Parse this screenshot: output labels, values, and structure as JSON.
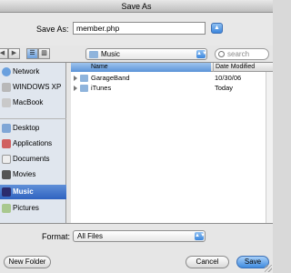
{
  "window": {
    "title": "Save As"
  },
  "save_as": {
    "label": "Save As:",
    "value": "member.php"
  },
  "toolbar": {
    "back_icon": "arrow-left",
    "forward_icon": "arrow-right",
    "list_view_icon": "list",
    "column_view_icon": "columns",
    "location": "Music",
    "search_placeholder": "search"
  },
  "sidebar": {
    "items": [
      {
        "label": "Network",
        "icon": "globe-icon"
      },
      {
        "label": "WINDOWS XP",
        "icon": "drive-icon"
      },
      {
        "label": "MacBook",
        "icon": "drive-icon"
      },
      {
        "label": "Desktop",
        "icon": "desktop-icon"
      },
      {
        "label": "Applications",
        "icon": "applications-icon"
      },
      {
        "label": "Documents",
        "icon": "documents-icon"
      },
      {
        "label": "Movies",
        "icon": "movies-icon"
      },
      {
        "label": "Music",
        "icon": "music-icon",
        "selected": true
      },
      {
        "label": "Pictures",
        "icon": "pictures-icon"
      }
    ]
  },
  "file_list": {
    "columns": {
      "name": "Name",
      "date": "Date Modified"
    },
    "rows": [
      {
        "name": "GarageBand",
        "date": "10/30/06"
      },
      {
        "name": "iTunes",
        "date": "Today"
      }
    ]
  },
  "format": {
    "label": "Format:",
    "value": "All Files"
  },
  "buttons": {
    "new_folder": "New Folder",
    "cancel": "Cancel",
    "save": "Save"
  },
  "colors": {
    "accent": "#3c86dc",
    "selection": "#2f63c0"
  }
}
